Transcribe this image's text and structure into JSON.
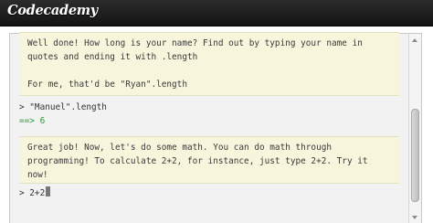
{
  "header": {
    "logo_text": "Codecademy"
  },
  "console": {
    "instruction_1": {
      "line_1": "Well done! How long is your name? Find out by typing your name in",
      "line_2": "quotes and ending it with .length",
      "line_3": "For me, that'd be \"Ryan\".length"
    },
    "input_1": "> \"Manuel\".length",
    "output_1": "==> 6",
    "instruction_2": {
      "line_1": "Great job! Now, let's do some math. You can do math through",
      "line_2": "programming! To calculate 2+2, for instance, just type 2+2. Try it",
      "line_3": "now!"
    },
    "current_input": "> 2+2"
  },
  "colors": {
    "header_bg": "#1c1c1c",
    "message_bg": "#f7f5dc",
    "result_green": "#2e9a3a",
    "console_bg": "#f2f2f2"
  }
}
